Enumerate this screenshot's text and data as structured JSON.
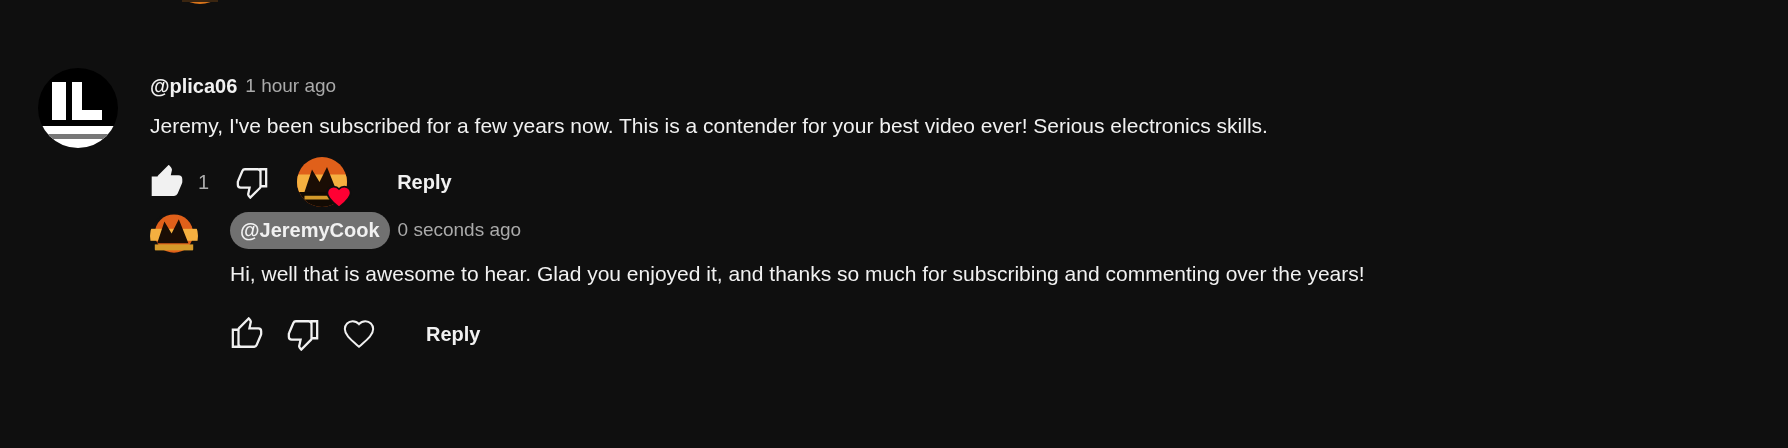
{
  "comments": [
    {
      "author": "@plica06",
      "author_highlighted": false,
      "time": "1 hour ago",
      "text": "Jeremy, I've been subscribed for a few years now. This is a contender for your best video ever! Serious electronics skills.",
      "liked": true,
      "like_count": "1",
      "hearted_by_creator": true,
      "reply_label": "Reply",
      "replies": [
        {
          "author": "@JeremyCook",
          "author_highlighted": true,
          "time": "0 seconds ago",
          "text": "Hi, well that is awesome to hear. Glad you enjoyed it, and thanks so much for subscribing and commenting over the years!",
          "liked": false,
          "hearted_by_creator": false,
          "reply_label": "Reply"
        }
      ]
    }
  ]
}
